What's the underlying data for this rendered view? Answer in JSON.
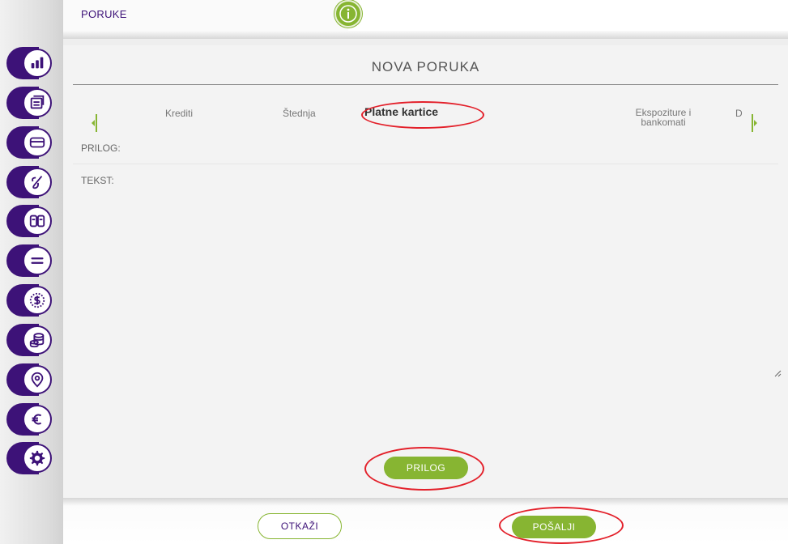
{
  "header": {
    "title": "PORUKE"
  },
  "panel": {
    "title": "NOVA PORUKA",
    "categories": {
      "prev_partial": "",
      "items": [
        "Krediti",
        "Štednja",
        "Platne kartice",
        "Ekspoziture i bankomati",
        "D"
      ],
      "active": "Platne kartice"
    },
    "prilog_label": "PRILOG:",
    "tekst_label": "TEKST:",
    "tekst_value": "",
    "prilog_button": "PRILOG"
  },
  "footer": {
    "cancel_label": "OTKAŽI",
    "send_label": "POŠALJI"
  },
  "sidebar": {
    "items": [
      {
        "icon": "accounts-chart-icon"
      },
      {
        "icon": "payments-icon"
      },
      {
        "icon": "card-icon"
      },
      {
        "icon": "loan-signature-icon"
      },
      {
        "icon": "exchange-devices-icon"
      },
      {
        "icon": "transfer-icon"
      },
      {
        "icon": "savings-dollar-icon"
      },
      {
        "icon": "coins-icon"
      },
      {
        "icon": "location-pin-icon"
      },
      {
        "icon": "euro-icon"
      },
      {
        "icon": "settings-gear-icon"
      }
    ]
  },
  "colors": {
    "brand_purple": "#3d1278",
    "accent_green": "#87b532",
    "annotation_red": "#e3202a"
  }
}
